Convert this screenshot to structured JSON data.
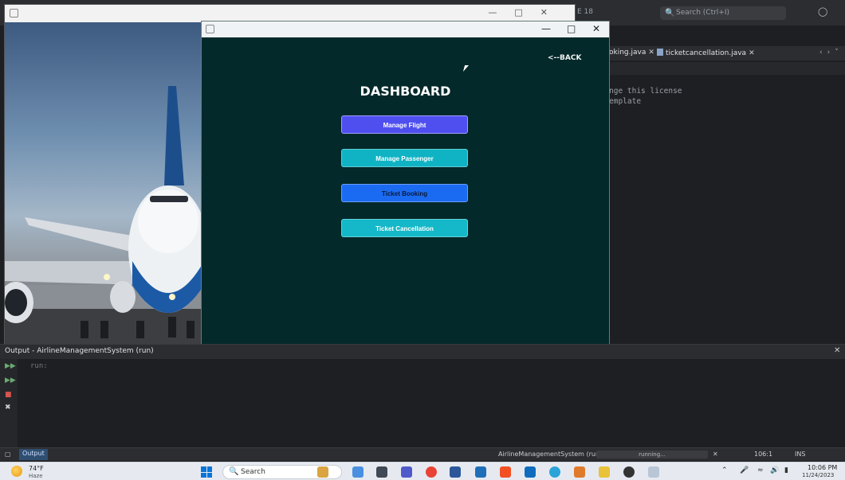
{
  "ide": {
    "title_fragment": "E 18",
    "search_placeholder": "Search (Ctrl+I)",
    "tabs": [
      {
        "label": "oking.java"
      },
      {
        "label": "ticketcancellation.java"
      }
    ],
    "code_lines": [
      "nge this license",
      "emplate"
    ]
  },
  "dashboard_window": {
    "back_label": "<--BACK",
    "title": "DASHBOARD",
    "buttons": {
      "manage_flight": "Manage Flight",
      "manage_passenger": "Manage Passenger",
      "ticket_booking": "Ticket Booking",
      "ticket_cancellation": "Ticket Cancellation"
    }
  },
  "output_panel": {
    "title": "Output - AirlineManagementSystem (run)",
    "text": "run:"
  },
  "statusbar": {
    "output_tab": "Output",
    "run_label": "AirlineManagementSystem (run)",
    "progress_label": "running...",
    "position": "106:1",
    "mode": "INS"
  },
  "taskbar": {
    "weather_temp": "74°F",
    "weather_condition": "Haze",
    "search_label": "Search",
    "time": "10:06 PM",
    "date": "11/24/2023"
  },
  "colors": {
    "dashboard_bg": "#04292a",
    "manage_flight": "#4f4ff0",
    "manage_passenger": "#10b3c4",
    "ticket_booking": "#1b6bf2",
    "ticket_cancellation": "#14b8c8"
  }
}
